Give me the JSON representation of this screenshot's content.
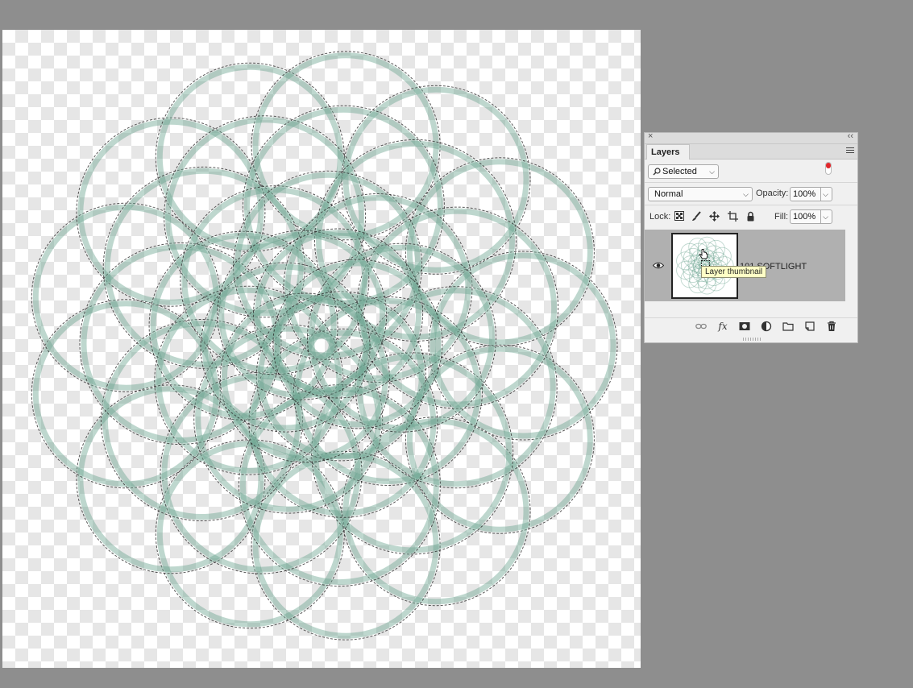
{
  "panel": {
    "tab_label": "Layers",
    "close_glyph": "×",
    "collapse_glyph": "‹‹",
    "filter": {
      "value": "Selected",
      "icon": "search-icon"
    },
    "blend_mode": "Normal",
    "opacity_label": "Opacity:",
    "opacity_value": "100%",
    "lock_label": "Lock:",
    "lock_icons": [
      "lock-transparent-pixels-icon",
      "lock-image-pixels-icon",
      "lock-position-icon",
      "lock-artboard-icon",
      "lock-all-icon"
    ],
    "fill_label": "Fill:",
    "fill_value": "100%",
    "layer": {
      "name": "101 SOFTLIGHT",
      "visible": true,
      "tooltip": "Layer thumbnail"
    },
    "bottom_icons": [
      "link-layers-icon",
      "layer-style-icon",
      "add-mask-icon",
      "adjustment-layer-icon",
      "new-group-icon",
      "new-layer-icon",
      "delete-icon"
    ],
    "fx_glyph": "fx"
  },
  "colors": {
    "workspace": "#8e8e8e",
    "ring_stroke": "#6fa693",
    "filter_toggle": "#e0262b",
    "tooltip_bg": "#ffffc6",
    "layer_row_selected": "#b0b0b0"
  }
}
